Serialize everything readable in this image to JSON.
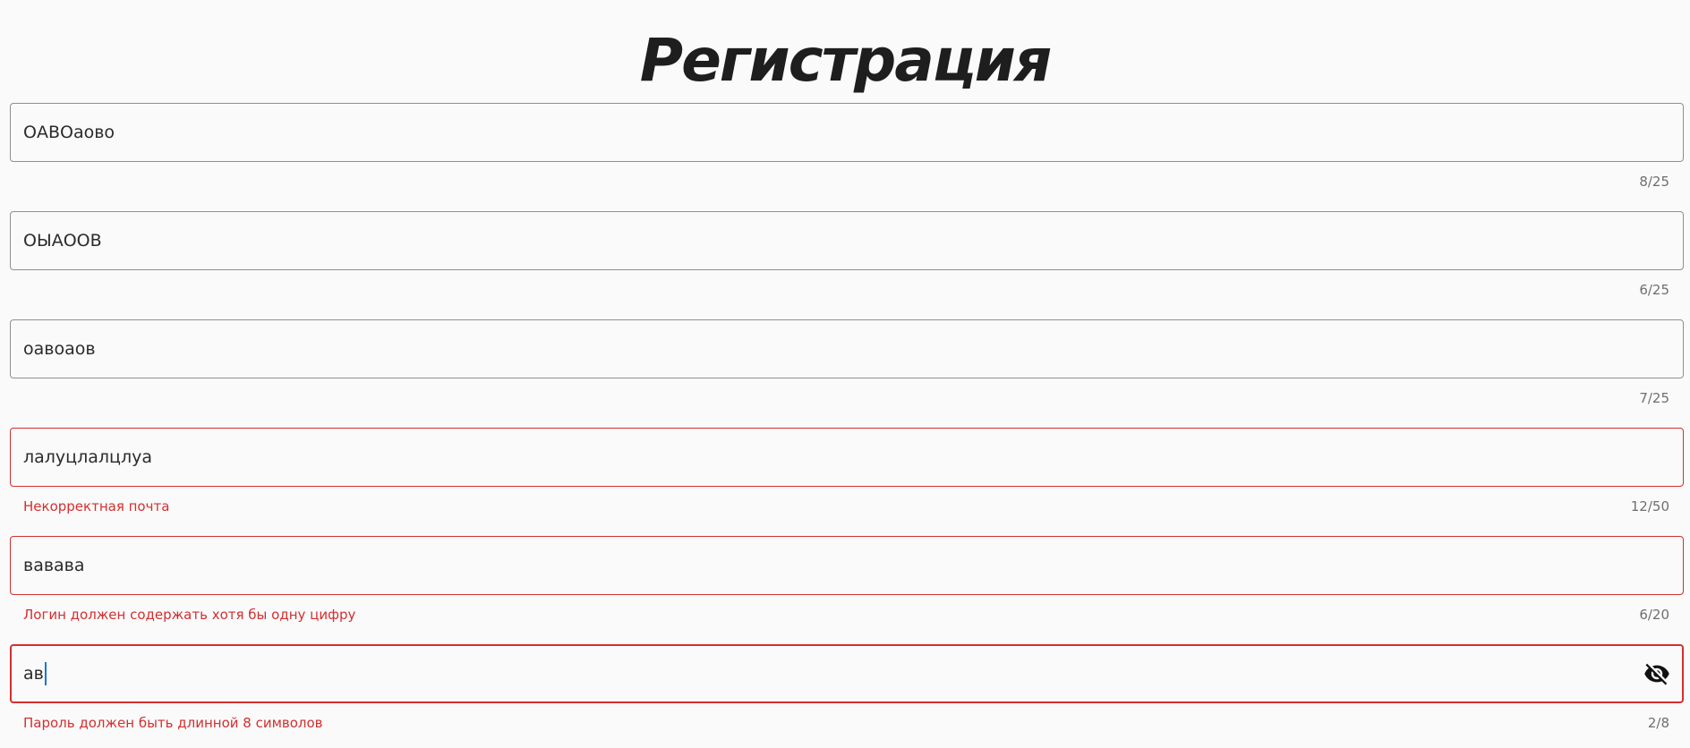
{
  "page": {
    "title": "Регистрация"
  },
  "fields": [
    {
      "value": "ОАВОаово",
      "helper": "",
      "counter": "8/25",
      "state": "normal"
    },
    {
      "value": "ОЫАООВ",
      "helper": "",
      "counter": "6/25",
      "state": "normal"
    },
    {
      "value": "оавоаов",
      "helper": "",
      "counter": "7/25",
      "state": "normal"
    },
    {
      "value": "лалуцлалцлуа",
      "helper": "Некорректная почта",
      "counter": "12/50",
      "state": "error"
    },
    {
      "value": "вавава",
      "helper": "Логин должен содержать хотя бы одну цифру",
      "counter": "6/20",
      "state": "error"
    },
    {
      "value": "ав",
      "helper": "Пароль должен быть длинной 8 символов",
      "counter": "2/8",
      "state": "error-focused"
    }
  ],
  "icons": {
    "password_toggle": "visibility-off-icon"
  },
  "colors": {
    "error": "#d32f2f",
    "border": "#8f8f8f",
    "caret": "#1976d2",
    "background": "#fafafa"
  }
}
